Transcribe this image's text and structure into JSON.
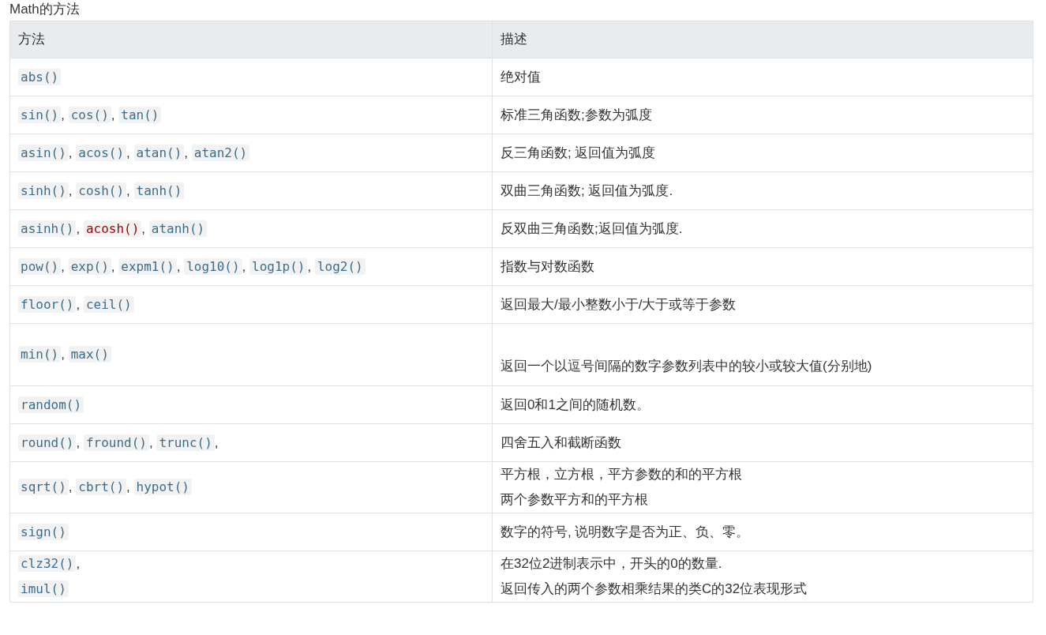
{
  "title": "Math的方法",
  "table": {
    "columns": [
      "方法",
      "描述"
    ],
    "rows": [
      {
        "method": [
          {
            "kind": "code",
            "text": "abs()",
            "color": "#3a6e8f"
          }
        ],
        "description": [
          "绝对值"
        ]
      },
      {
        "method": [
          {
            "kind": "code",
            "text": "sin()",
            "color": "#3a6e8f"
          },
          {
            "kind": "text",
            "text": ", "
          },
          {
            "kind": "code",
            "text": "cos()",
            "color": "#3a6e8f"
          },
          {
            "kind": "text",
            "text": ", "
          },
          {
            "kind": "code",
            "text": "tan()",
            "color": "#3a6e8f"
          }
        ],
        "description": [
          "标准三角函数;参数为弧度"
        ]
      },
      {
        "method": [
          {
            "kind": "code",
            "text": "asin()",
            "color": "#3a6e8f"
          },
          {
            "kind": "text",
            "text": ", "
          },
          {
            "kind": "code",
            "text": "acos()",
            "color": "#3a6e8f"
          },
          {
            "kind": "text",
            "text": ", "
          },
          {
            "kind": "code",
            "text": "atan()",
            "color": "#3a6e8f"
          },
          {
            "kind": "text",
            "text": ", "
          },
          {
            "kind": "code",
            "text": "atan2()",
            "color": "#3a6e8f"
          }
        ],
        "description": [
          "反三角函数; 返回值为弧度"
        ]
      },
      {
        "method": [
          {
            "kind": "code",
            "text": "sinh()",
            "color": "#3a6e8f"
          },
          {
            "kind": "text",
            "text": ", "
          },
          {
            "kind": "code",
            "text": "cosh()",
            "color": "#3a6e8f"
          },
          {
            "kind": "text",
            "text": ", "
          },
          {
            "kind": "code",
            "text": "tanh()",
            "color": "#3a6e8f"
          }
        ],
        "description": [
          "双曲三角函数; 返回值为弧度."
        ]
      },
      {
        "method": [
          {
            "kind": "code",
            "text": "asinh()",
            "color": "#3a6e8f"
          },
          {
            "kind": "text",
            "text": ", "
          },
          {
            "kind": "code",
            "text": "acosh()",
            "color": "#990000"
          },
          {
            "kind": "text",
            "text": ", "
          },
          {
            "kind": "code",
            "text": "atanh()",
            "color": "#3a6e8f"
          }
        ],
        "description": [
          "反双曲三角函数;返回值为弧度."
        ]
      },
      {
        "method": [
          {
            "kind": "code",
            "text": "pow()",
            "color": "#3a6e8f"
          },
          {
            "kind": "text",
            "text": ", "
          },
          {
            "kind": "code",
            "text": "exp()",
            "color": "#3a6e8f"
          },
          {
            "kind": "text",
            "text": ", "
          },
          {
            "kind": "code",
            "text": "expm1()",
            "color": "#3a6e8f"
          },
          {
            "kind": "text",
            "text": ", "
          },
          {
            "kind": "code",
            "text": "log10()",
            "color": "#3a6e8f"
          },
          {
            "kind": "text",
            "text": ", "
          },
          {
            "kind": "code",
            "text": "log1p()",
            "color": "#3a6e8f"
          },
          {
            "kind": "text",
            "text": ", "
          },
          {
            "kind": "code",
            "text": "log2()",
            "color": "#3a6e8f"
          }
        ],
        "description": [
          "指数与对数函数"
        ]
      },
      {
        "method": [
          {
            "kind": "code",
            "text": "floor()",
            "color": "#3a6e8f"
          },
          {
            "kind": "text",
            "text": ", "
          },
          {
            "kind": "code",
            "text": "ceil()",
            "color": "#3a6e8f"
          }
        ],
        "description": [
          "返回最大/最小整数小于/大于或等于参数"
        ]
      },
      {
        "method": [
          {
            "kind": "code",
            "text": "min()",
            "color": "#3a6e8f"
          },
          {
            "kind": "text",
            "text": ", "
          },
          {
            "kind": "code",
            "text": "max()",
            "color": "#3a6e8f"
          }
        ],
        "description": [
          "返回一个以逗号间隔的数字参数列表中的较小或较大值(分别地)"
        ],
        "tall": true
      },
      {
        "method": [
          {
            "kind": "code",
            "text": "random()",
            "color": "#3a6e8f"
          }
        ],
        "description": [
          "返回0和1之间的随机数。"
        ]
      },
      {
        "method": [
          {
            "kind": "code",
            "text": "round()",
            "color": "#3a6e8f"
          },
          {
            "kind": "text",
            "text": ", "
          },
          {
            "kind": "code",
            "text": "fround()",
            "color": "#3a6e8f"
          },
          {
            "kind": "text",
            "text": ", "
          },
          {
            "kind": "code",
            "text": "trunc()",
            "color": "#3a6e8f"
          },
          {
            "kind": "text",
            "text": ","
          }
        ],
        "description": [
          "四舍五入和截断函数"
        ]
      },
      {
        "method": [
          {
            "kind": "code",
            "text": "sqrt()",
            "color": "#3a6e8f"
          },
          {
            "kind": "text",
            "text": ", "
          },
          {
            "kind": "code",
            "text": "cbrt()",
            "color": "#3a6e8f"
          },
          {
            "kind": "text",
            "text": ", "
          },
          {
            "kind": "code",
            "text": "hypot()",
            "color": "#3a6e8f"
          }
        ],
        "description": [
          "平方根，立方根，平方参数的和的平方根",
          "两个参数平方和的平方根"
        ]
      },
      {
        "method": [
          {
            "kind": "code",
            "text": "sign()",
            "color": "#3a6e8f"
          }
        ],
        "description": [
          "数字的符号, 说明数字是否为正、负、零。"
        ]
      },
      {
        "method": [
          {
            "kind": "code",
            "text": "clz32()",
            "color": "#3a6e8f"
          },
          {
            "kind": "text",
            "text": ","
          },
          {
            "kind": "break"
          },
          {
            "kind": "code",
            "text": "imul()",
            "color": "#3a6e8f"
          }
        ],
        "description": [
          "在32位2进制表示中，开头的0的数量.",
          "返回传入的两个参数相乘结果的类C的32位表现形式"
        ]
      }
    ]
  }
}
